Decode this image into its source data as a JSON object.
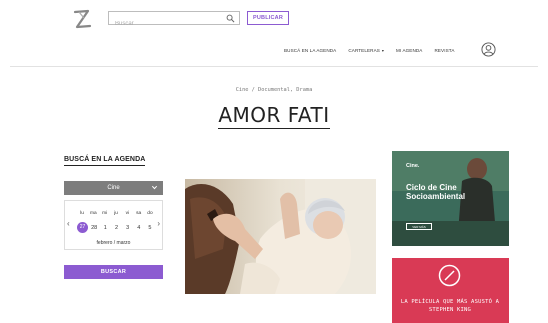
{
  "header": {
    "search_placeholder": "Buscar",
    "publish_label": "PUBLICAR"
  },
  "nav": {
    "items": [
      {
        "label": "BUSCÁ EN LA AGENDA"
      },
      {
        "label": "CARTELERAS",
        "has_dropdown": true
      },
      {
        "label": "MI AGENDA"
      },
      {
        "label": "REVISTA"
      }
    ]
  },
  "movie": {
    "genres": "Cine / Documental, Drama",
    "title": "AMOR FATI"
  },
  "agenda": {
    "heading": "BUSCÁ EN LA AGENDA",
    "category": "Cine",
    "weekdays": [
      "lu",
      "ma",
      "mi",
      "ju",
      "vi",
      "sa",
      "do"
    ],
    "days": [
      "27",
      "28",
      "1",
      "2",
      "3",
      "4",
      "5"
    ],
    "selected_day": "27",
    "month_label": "febrero / marzo",
    "search_button": "BUSCAR"
  },
  "ads": [
    {
      "brand": "Cine.",
      "title": "Ciclo de Cine Socioambiental",
      "cta": "VER MÁS"
    },
    {
      "text": "LA PELÍCULA QUE MÁS ASUSTÓ A STEPHEN KING"
    }
  ],
  "colors": {
    "accent": "#8c5bd1",
    "select_gray": "#7d7d7d",
    "ad1_bg": "#2f5f52",
    "ad2_bg": "#d93a55"
  }
}
